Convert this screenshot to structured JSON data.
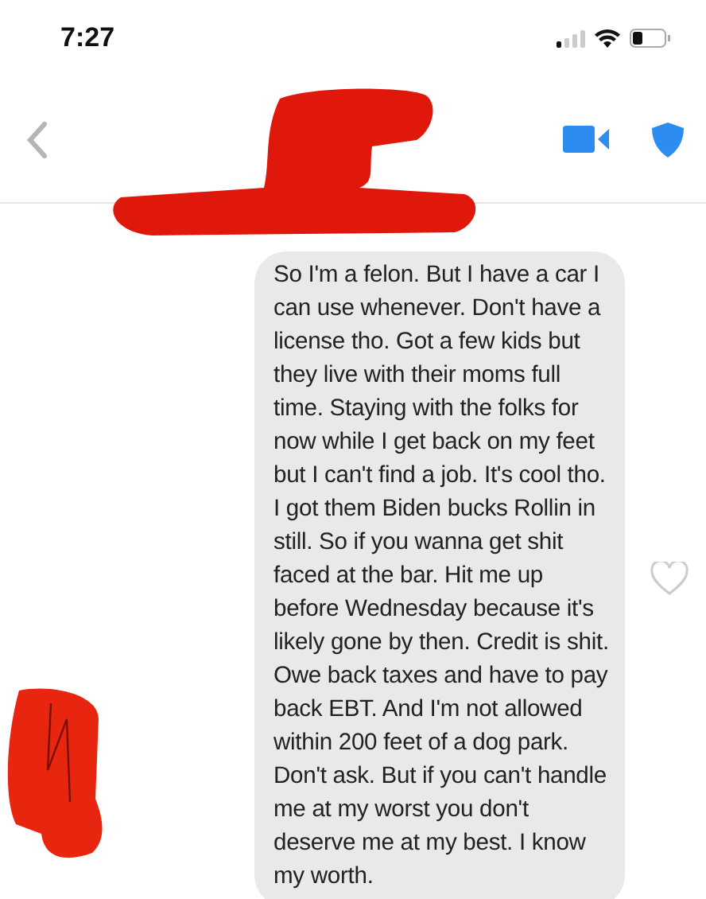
{
  "status_bar": {
    "time": "7:27"
  },
  "message": {
    "text": "So I'm a felon. But I have a car I can use whenever. Don't have a license tho. Got a few kids but they live with their moms full time. Staying with the folks for now while I get back on my feet but I can't find a job. It's cool tho. I got them Biden bucks Rollin in still. So if you wanna get shit faced at the bar. Hit me up before Wednesday because it's likely gone by then. Credit is shit. Owe back taxes and have to pay back EBT. And I'm not allowed within 200 feet of a dog park. Don't ask. But if you can't handle me at my worst you don't deserve me at my best. I know my worth.",
    "liked": false
  }
}
